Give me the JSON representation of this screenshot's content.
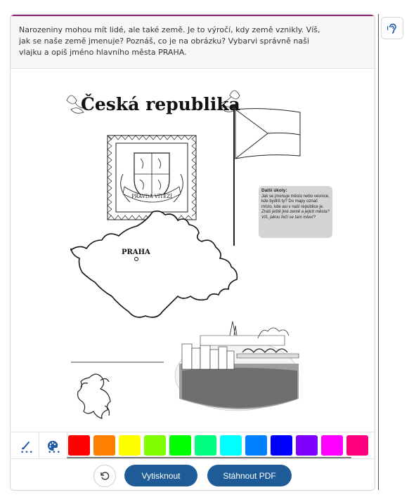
{
  "instructions": {
    "text": "Narozeniny mohou mít lidé, ale také země. Je to výročí, kdy země vznikly. Víš, jak se naše země jmenuje? Poznáš, co je na obrázku? Vybarvi správně naši vlajku a opiš jméno hlavního města PRAHA."
  },
  "sheet": {
    "title": "Česká republika",
    "motto": "PRAVDA VÍTĚZÍ",
    "city_label": "PRAHA",
    "tasks": {
      "heading": "Další úkoly:",
      "line1": "Jak se jmenuje město nebo vesnice, kde bydlíš ty? Do mapy označ místo, kde asi v naší republice je.",
      "line2": "Znáš ještě jiné země a jejich města? Víš, jakou řečí se tam mluví?"
    }
  },
  "toolbar": {
    "brush_icon": "brush-icon",
    "palette_icon": "palette-icon",
    "swatches": [
      "#ff0000",
      "#ff7f00",
      "#ffff00",
      "#80ff00",
      "#00ff00",
      "#00ff80",
      "#00ffff",
      "#0080ff",
      "#0000ff",
      "#8000ff",
      "#ff00ff",
      "#ff0080"
    ]
  },
  "actions": {
    "reset_icon": "reset-icon",
    "print_label": "Vytisknout",
    "download_label": "Stáhnout PDF"
  },
  "side": {
    "listen_icon": "ear-icon"
  }
}
